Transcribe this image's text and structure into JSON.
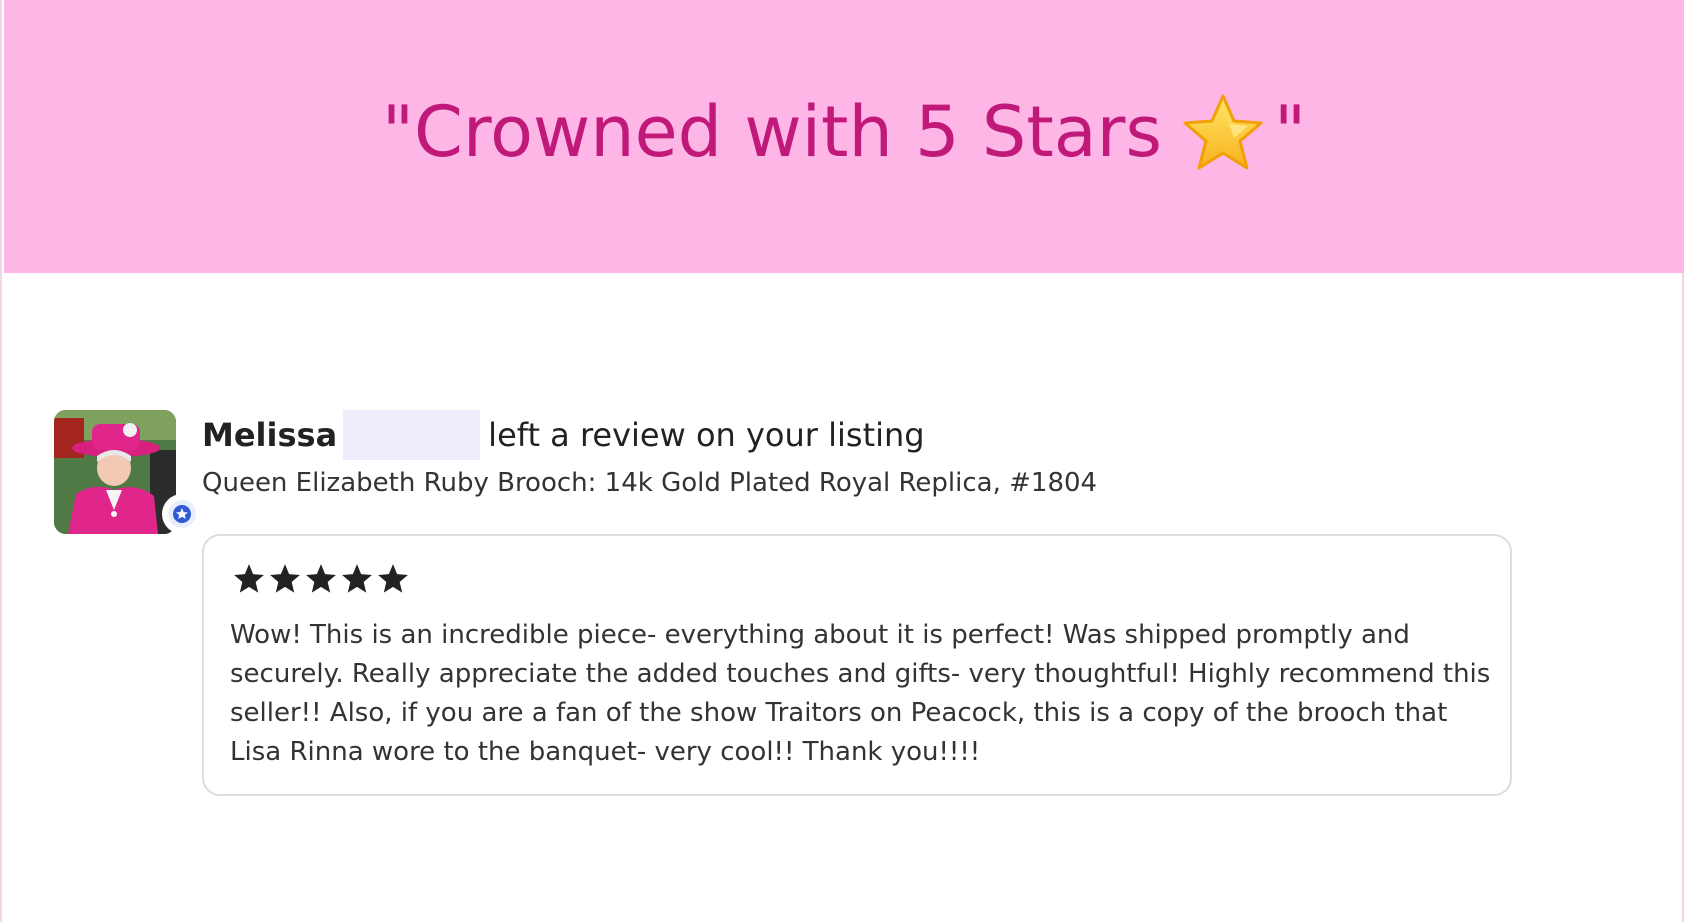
{
  "banner": {
    "quote_open": "\"Crowned with 5 Stars",
    "quote_close": "\"",
    "star_icon": "glowing-star-emoji",
    "background_color": "#fdb6e6",
    "title_color": "#c0197a"
  },
  "review": {
    "reviewer_name": "Melissa",
    "action_text": "left a review on your listing",
    "listing_title": "Queen Elizabeth Ruby Brooch: 14k Gold Plated Royal Replica, #1804",
    "rating": 5,
    "rating_max": 5,
    "text": "Wow! This is an incredible piece- everything about it is perfect! Was shipped promptly and securely. Really appreciate the added touches and gifts- very thoughtful! Highly recommend this seller!! Also, if you are a fan of the show Traitors on Peacock, this is a copy of the brooch that Lisa Rinna wore to the banquet- very cool!! Thank you!!!!",
    "avatar_icon": "reviewer-avatar",
    "badge_icon": "star-badge-icon"
  }
}
